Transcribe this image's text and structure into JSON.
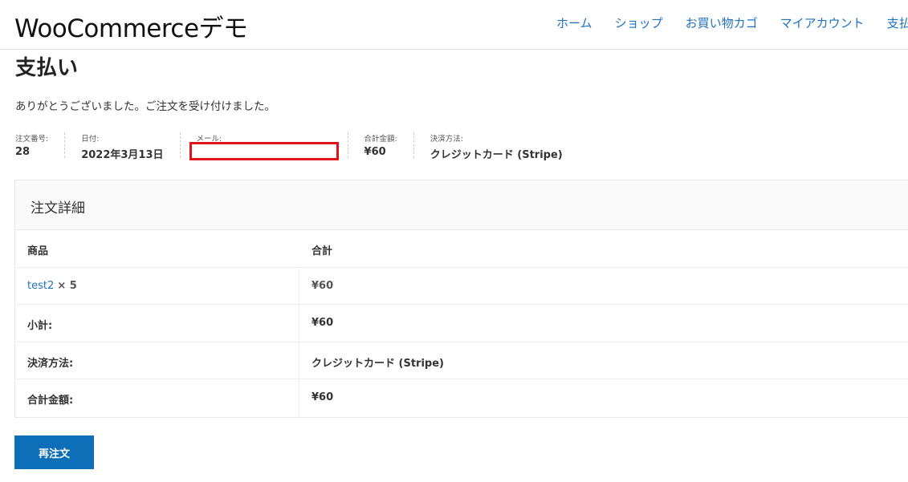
{
  "site_title": "WooCommerceデモ",
  "nav": [
    "ホーム",
    "ショップ",
    "お買い物カゴ",
    "マイアカウント",
    "支払い"
  ],
  "page_title": "支払い",
  "thanks": "ありがとうございました。ご注文を受け付けました。",
  "overview": {
    "order_label": "注文番号:",
    "order": "28",
    "date_label": "日付:",
    "date": "2022年3月13日",
    "email_label": "メール:",
    "total_label": "合計金額:",
    "total": "¥60",
    "method_label": "決済方法:",
    "method": "クレジットカード (Stripe)"
  },
  "details": {
    "title": "注文詳細",
    "col_product": "商品",
    "col_total": "合計",
    "item_name": "test2",
    "item_qty": "× 5",
    "item_total": "¥60",
    "subtotal_label": "小計:",
    "subtotal": "¥60",
    "payment_label": "決済方法:",
    "payment": "クレジットカード (Stripe)",
    "grand_label": "合計金額:",
    "grand": "¥60"
  },
  "reorder": "再注文"
}
